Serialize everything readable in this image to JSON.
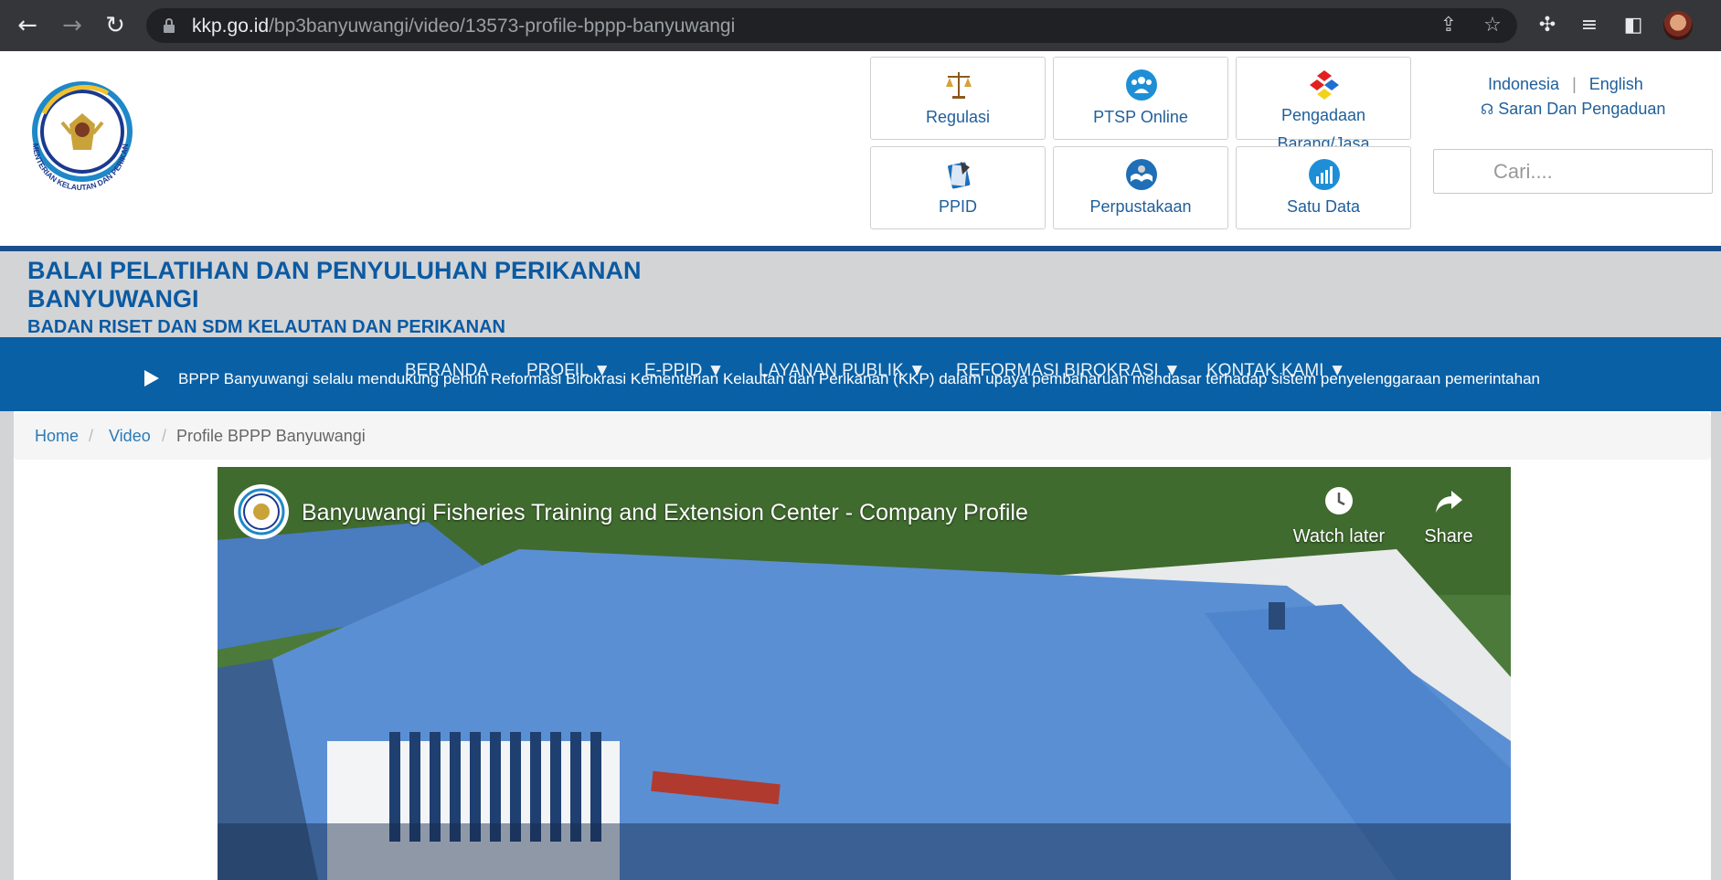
{
  "browser": {
    "url_host": "kkp.go.id",
    "url_path": "/bp3banyuwangi/video/13573-profile-bppp-banyuwangi"
  },
  "header": {
    "logo_caption": "KEMENTERIAN KELAUTAN DAN PERIKANAN",
    "tiles": [
      {
        "label": "Regulasi",
        "icon": "scales-icon"
      },
      {
        "label": "PTSP Online",
        "icon": "people-group-icon"
      },
      {
        "label": "Pengadaan Barang/Jasa",
        "icon": "shapes-icon"
      },
      {
        "label": "PPID",
        "icon": "books-icon"
      },
      {
        "label": "Perpustakaan",
        "icon": "open-book-icon"
      },
      {
        "label": "Satu Data",
        "icon": "bar-chart-icon"
      }
    ],
    "lang": {
      "indonesia": "Indonesia",
      "separator": "|",
      "english": "English"
    },
    "saran": "Saran Dan Pengaduan",
    "search_placeholder": "Cari...."
  },
  "title_band": {
    "title": "BALAI PELATIHAN DAN PENYULUHAN PERIKANAN BANYUWANGI",
    "subtitle": "BADAN RISET DAN SDM KELAUTAN DAN PERIKANAN"
  },
  "nav": {
    "ticker": "BPPP Banyuwangi selalu mendukung penuh Reformasi Birokrasi Kementerian Kelautan dan Perikanan (KKP) dalam upaya pembaharuan mendasar terhadap sistem penyelenggaraan pemerintahan",
    "items": [
      "BERANDA",
      "PROFIL ▼",
      "E-PPID ▼",
      "LAYANAN PUBLIK ▼",
      "REFORMASI BIROKRASI ▼",
      "KONTAK KAMI ▼"
    ]
  },
  "breadcrumb": {
    "home": "Home",
    "video": "Video",
    "current": "Profile BPPP Banyuwangi",
    "separator": "/"
  },
  "video": {
    "title": "Banyuwangi Fisheries Training and Extension Center - Company Profile",
    "watch_later": "Watch later",
    "share": "Share"
  },
  "colors": {
    "brand_blue": "#0960a5",
    "title_blue": "#0b5aa2",
    "link_blue": "#1f5f9a"
  }
}
